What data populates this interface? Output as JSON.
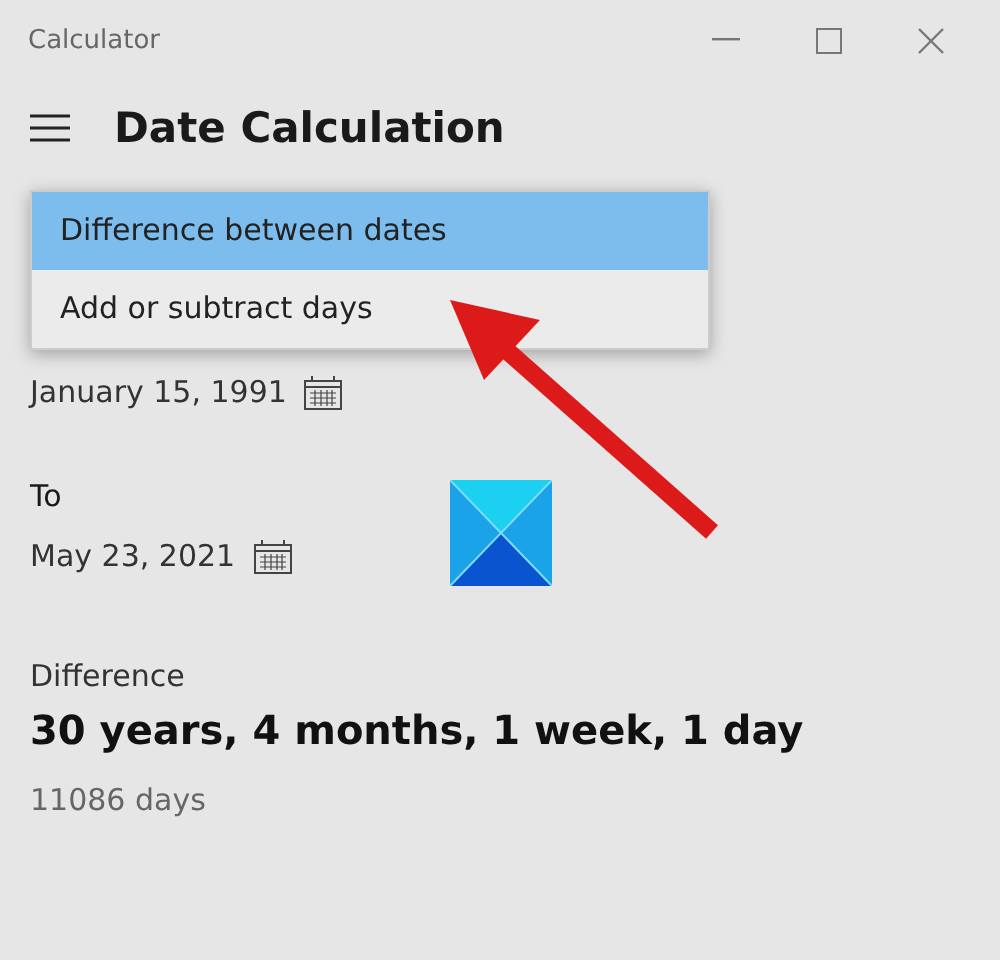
{
  "window": {
    "title": "Calculator"
  },
  "header": {
    "title": "Date Calculation"
  },
  "mode_menu": [
    {
      "label": "Difference between dates",
      "selected": true
    },
    {
      "label": "Add or subtract days",
      "selected": false
    }
  ],
  "from_date": "January 15, 1991",
  "to": {
    "label": "To",
    "date": "May 23, 2021"
  },
  "difference": {
    "label": "Difference",
    "value": "30 years, 4 months, 1 week, 1 day",
    "days": "11086 days"
  }
}
